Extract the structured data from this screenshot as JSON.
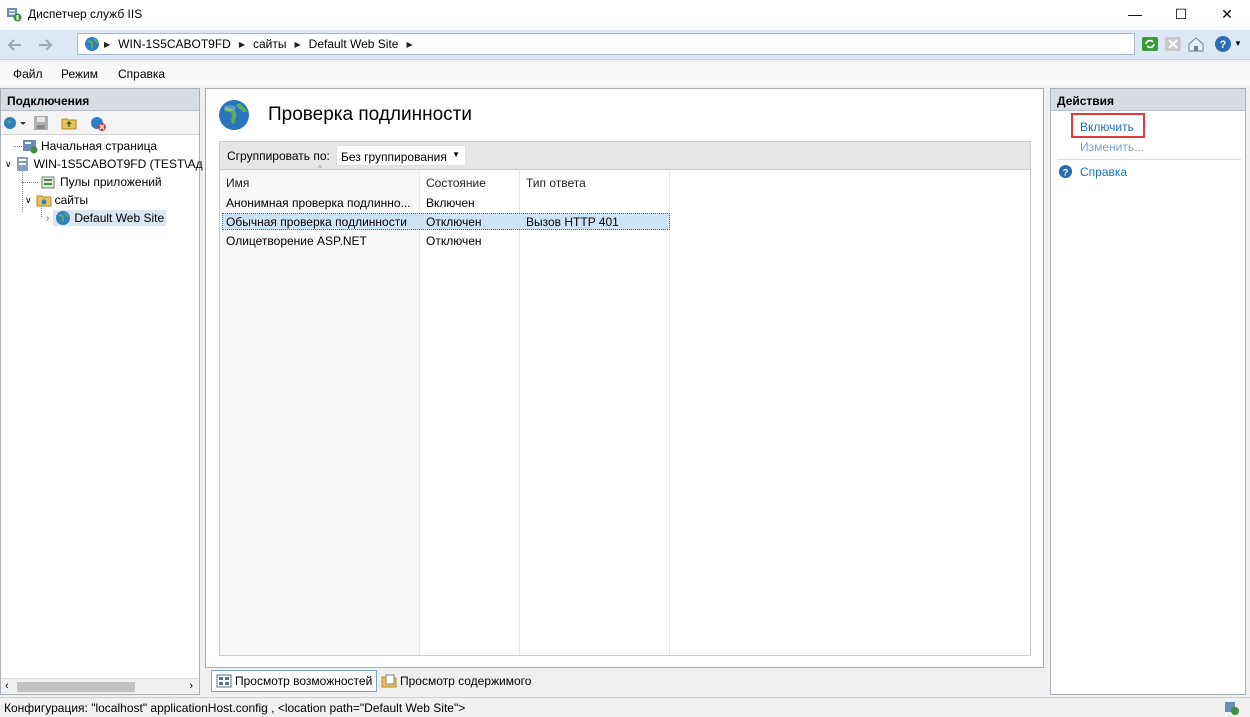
{
  "window": {
    "title": "Диспетчер служб IIS",
    "minimize_glyph": "—",
    "maximize_glyph": "☐",
    "close_glyph": "✕"
  },
  "address": {
    "crumbs": [
      "WIN-1S5CABOT9FD",
      "сайты",
      "Default Web Site"
    ]
  },
  "menu": [
    "Файл",
    "Режим",
    "Справка"
  ],
  "connections": {
    "header": "Подключения",
    "tree": [
      {
        "label": "Начальная страница"
      },
      {
        "label": "WIN-1S5CABOT9FD (TEST\\Ад"
      },
      {
        "label": "Пулы приложений"
      },
      {
        "label": "сайты"
      },
      {
        "label": "Default Web Site"
      }
    ]
  },
  "feature": {
    "title": "Проверка подлинности",
    "group_by_label": "Сгруппировать по:",
    "group_by_value": "Без группирования",
    "columns": [
      "Имя",
      "Состояние",
      "Тип ответа"
    ],
    "rows": [
      {
        "name": "Анонимная проверка подлинно...",
        "state": "Включен",
        "response": ""
      },
      {
        "name": "Обычная проверка подлинности",
        "state": "Отключен",
        "response": "Вызов HTTP 401"
      },
      {
        "name": "Олицетворение ASP.NET",
        "state": "Отключен",
        "response": ""
      }
    ],
    "selected_row": 1
  },
  "tabs": [
    "Просмотр возможностей",
    "Просмотр содержимого"
  ],
  "actions": {
    "header": "Действия",
    "enable": "Включить",
    "edit": "Изменить...",
    "help": "Справка"
  },
  "status": {
    "text": "Конфигурация: \"localhost\" applicationHost.config , <location path=\"Default Web Site\">"
  },
  "colors": {
    "accent": "#1a6fc2",
    "highlight_box": "#e03b3b",
    "selected_row": "#cde4f7"
  }
}
